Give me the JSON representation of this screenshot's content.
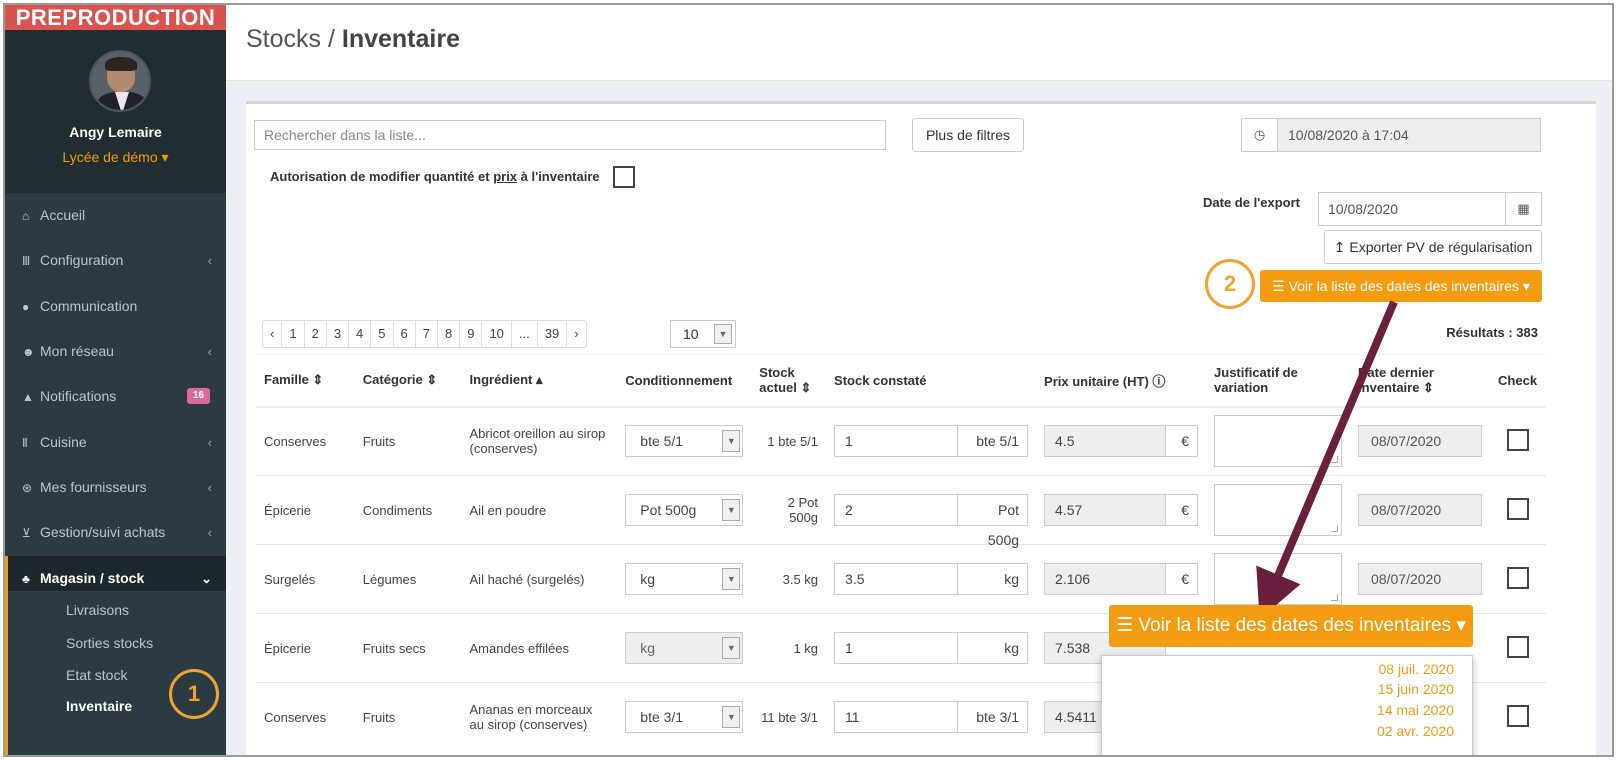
{
  "brand": "PREPRODUCTION",
  "user": {
    "name": "Angy Lemaire",
    "school": "Lycée de démo ▾"
  },
  "nav": {
    "accueil": "Accueil",
    "configuration": "Configuration",
    "communication": "Communication",
    "reseau": "Mon réseau",
    "notifications": "Notifications",
    "notifications_badge": "16",
    "cuisine": "Cuisine",
    "fournisseurs": "Mes fournisseurs",
    "achats": "Gestion/suivi achats",
    "magasin": "Magasin / stock",
    "sub": {
      "livraisons": "Livraisons",
      "sorties": "Sorties stocks",
      "etat": "Etat stock",
      "inventaire": "Inventaire"
    }
  },
  "title": {
    "prefix": "Stocks / ",
    "main": "Inventaire"
  },
  "toolbar": {
    "search_placeholder": "Rechercher dans la liste...",
    "filters_label": "Plus de filtres",
    "datetime_value": "10/08/2020 à 17:04",
    "auth_label_1": "Autorisation de modifier quantité et ",
    "auth_label_2": "prix",
    "auth_label_3": " à l'inventaire",
    "export_date_label": "Date de l'export",
    "export_date_value": "10/08/2020",
    "export_label": "Exporter PV de régularisation",
    "dates_label": "Voir la liste des dates des inventaires",
    "dates_label_big": "Voir la liste des dates des inventaires"
  },
  "pagination": {
    "prev": "‹",
    "next": "›",
    "pages": [
      "1",
      "2",
      "3",
      "4",
      "5",
      "6",
      "7",
      "8",
      "9",
      "10",
      "...",
      "39"
    ],
    "page_size": "10"
  },
  "results": "Résultats : 383",
  "table": {
    "headers": {
      "famille": "Famille ⇕",
      "categorie": "Catégorie ⇕",
      "ingredient": "Ingrédient ▴",
      "conditionnement": "Conditionnement",
      "stock_actuel_1": "Stock",
      "stock_actuel_2": "actuel ⇕",
      "stock_constate": "Stock constaté",
      "prix": "Prix unitaire (HT) ⓘ",
      "justif_1": "Justificatif de",
      "justif_2": "variation",
      "date_1": "Date dernier",
      "date_2": "inventaire ⇕",
      "check": "Check"
    },
    "rows": [
      {
        "famille": "Conserves",
        "categorie": "Fruits",
        "ingredient": "Abricot oreillon au sirop (conserves)",
        "cond": "bte 5/1",
        "stock": "1 bte 5/1",
        "constate": "1",
        "unit": "bte 5/1",
        "prix": "4.5",
        "currency": "€",
        "date": "08/07/2020"
      },
      {
        "famille": "Épicerie",
        "categorie": "Condiments",
        "ingredient": "Ail en poudre",
        "cond": "Pot 500g",
        "stock": "2 Pot 500g",
        "constate": "2",
        "unit": "Pot 500g",
        "prix": "4.57",
        "currency": "€",
        "date": "08/07/2020"
      },
      {
        "famille": "Surgelés",
        "categorie": "Légumes",
        "ingredient": "Ail haché (surgelés)",
        "cond": "kg",
        "stock": "3.5 kg",
        "constate": "3.5",
        "unit": "kg",
        "prix": "2.106",
        "currency": "€",
        "date": "08/07/2020"
      },
      {
        "famille": "Épicerie",
        "categorie": "Fruits secs",
        "ingredient": "Amandes effilées",
        "cond": "kg",
        "stock": "1 kg",
        "constate": "1",
        "unit": "kg",
        "prix": "7.538",
        "currency": "",
        "date": ""
      },
      {
        "famille": "Conserves",
        "categorie": "Fruits",
        "ingredient": "Ananas en morceaux au sirop (conserves)",
        "cond": "bte 3/1",
        "stock": "11 bte 3/1",
        "constate": "11",
        "unit": "bte 3/1",
        "prix": "4.5411",
        "currency": "",
        "date": ""
      }
    ]
  },
  "dropdown": [
    "08 juil. 2020",
    "15 juin 2020",
    "14 mai 2020",
    "02 avr. 2020"
  ],
  "callouts": [
    "1",
    "2"
  ],
  "colors": {
    "accent": "#f39c12",
    "sidebar": "#2c3b41",
    "brand_red": "#d9534f",
    "arrow": "#6b1f3e"
  }
}
